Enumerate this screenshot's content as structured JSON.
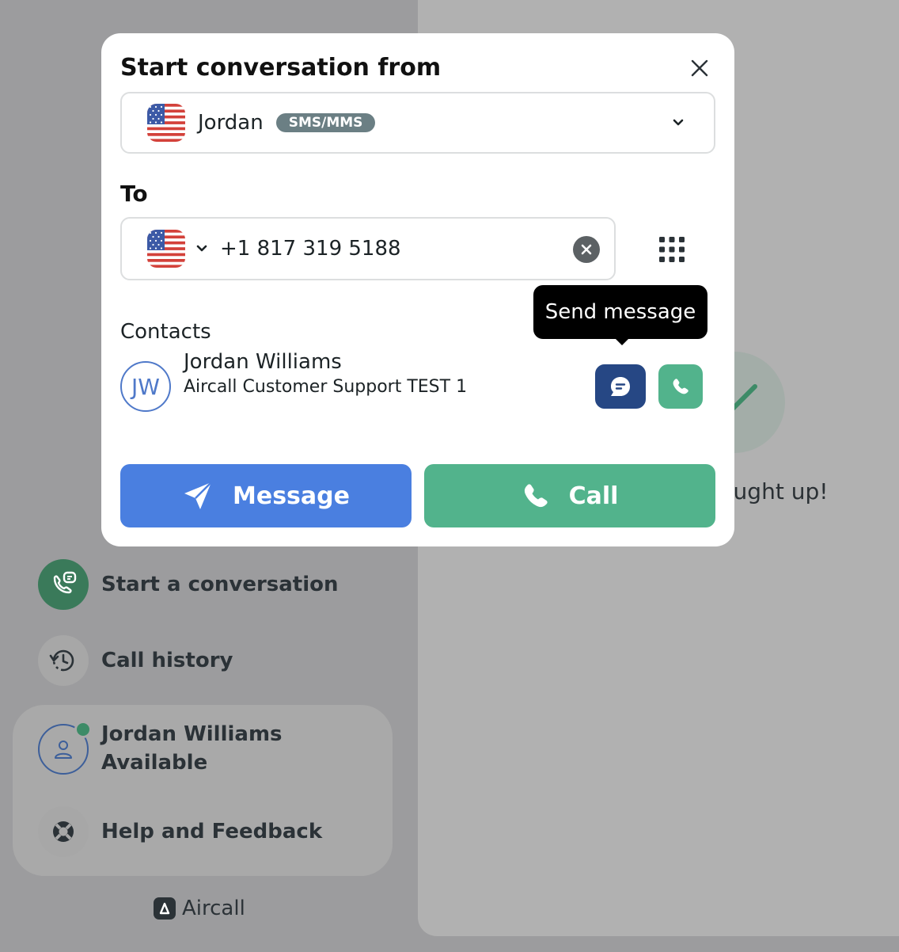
{
  "modal": {
    "title": "Start conversation from",
    "from": {
      "name": "Jordan",
      "badge": "SMS/MMS"
    },
    "to": {
      "label": "To",
      "phone_value": "+1 817 319 5188"
    },
    "contacts": {
      "label": "Contacts",
      "items": [
        {
          "initials": "JW",
          "name": "Jordan Williams",
          "company": "Aircall Customer Support TEST 1"
        }
      ]
    },
    "tooltip": "Send message",
    "message_label": "Message",
    "call_label": "Call"
  },
  "background": {
    "caught_up_text": "caught up!",
    "nav": {
      "start": "Start a conversation",
      "history": "Call history",
      "help": "Help and Feedback"
    },
    "user": {
      "name": "Jordan Williams",
      "status": "Available"
    },
    "brand": "Aircall"
  },
  "colors": {
    "primary_blue": "#4a7fe0",
    "call_green": "#52b38c",
    "dark_blue": "#264784",
    "badge_gray": "#6b7f84",
    "presence_green": "#3d8b67"
  }
}
